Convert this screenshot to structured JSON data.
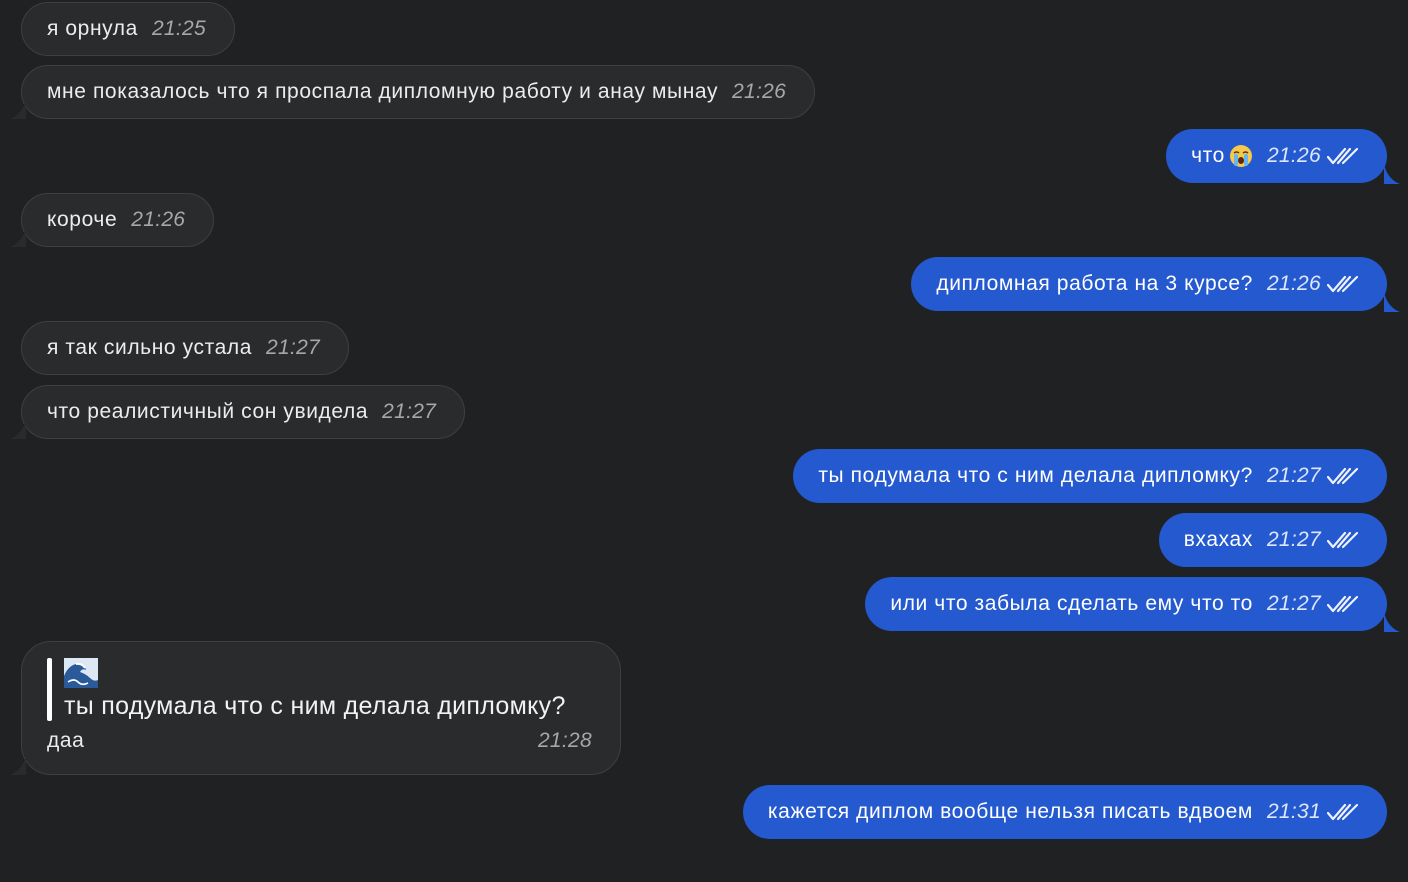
{
  "messages": [
    {
      "text": "я орнула",
      "time": "21:25"
    },
    {
      "text": "мне показалось что я проспала дипломную работу и анау мынау",
      "time": "21:26"
    },
    {
      "text": "что",
      "time": "21:26",
      "emoji": "crying-face-emoji"
    },
    {
      "text": "короче",
      "time": "21:26"
    },
    {
      "text": "дипломная работа на 3 курсе?",
      "time": "21:26"
    },
    {
      "text": "я так сильно устала",
      "time": "21:27"
    },
    {
      "text": "что реалистичный сон увидела",
      "time": "21:27"
    },
    {
      "text": "ты подумала что с ним делала дипломку?",
      "time": "21:27"
    },
    {
      "text": "вхахах",
      "time": "21:27"
    },
    {
      "text": "или что забыла сделать ему что то",
      "time": "21:27"
    },
    {
      "quote_icon": "wave-emoji",
      "quote_text": "ты подумала что с ним делала дипломку?",
      "text": "даа",
      "time": "21:28"
    },
    {
      "text": "кажется диплом вообще нельзя писать вдвоем",
      "time": "21:31"
    }
  ],
  "colors": {
    "background": "#202122",
    "incoming_bubble": "#2a2b2c",
    "outgoing_bubble": "#2459cf"
  },
  "icons": {
    "read_status": "double-check-icon"
  }
}
